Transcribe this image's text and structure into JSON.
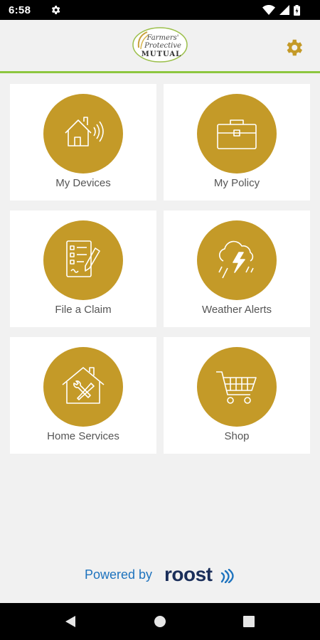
{
  "status_bar": {
    "time": "6:58",
    "icons": [
      "settings-icon",
      "wifi-icon",
      "cellular-icon",
      "battery-icon"
    ]
  },
  "header": {
    "logo_lines": [
      "Farmers'",
      "Protective",
      "MUTUAL"
    ],
    "settings_icon": "gear-icon"
  },
  "tiles": [
    {
      "label": "My Devices",
      "icon": "smart-home-icon"
    },
    {
      "label": "My Policy",
      "icon": "briefcase-icon"
    },
    {
      "label": "File a Claim",
      "icon": "claim-form-icon"
    },
    {
      "label": "Weather Alerts",
      "icon": "storm-cloud-icon"
    },
    {
      "label": "Home Services",
      "icon": "home-tools-icon"
    },
    {
      "label": "Shop",
      "icon": "shopping-cart-icon"
    }
  ],
  "footer": {
    "powered_by": "Powered by",
    "brand": "roost"
  },
  "colors": {
    "accent_gold": "#c49a28",
    "divider_green": "#8dc63f",
    "powered_blue": "#1e73be",
    "brand_navy": "#1a2e5a"
  }
}
